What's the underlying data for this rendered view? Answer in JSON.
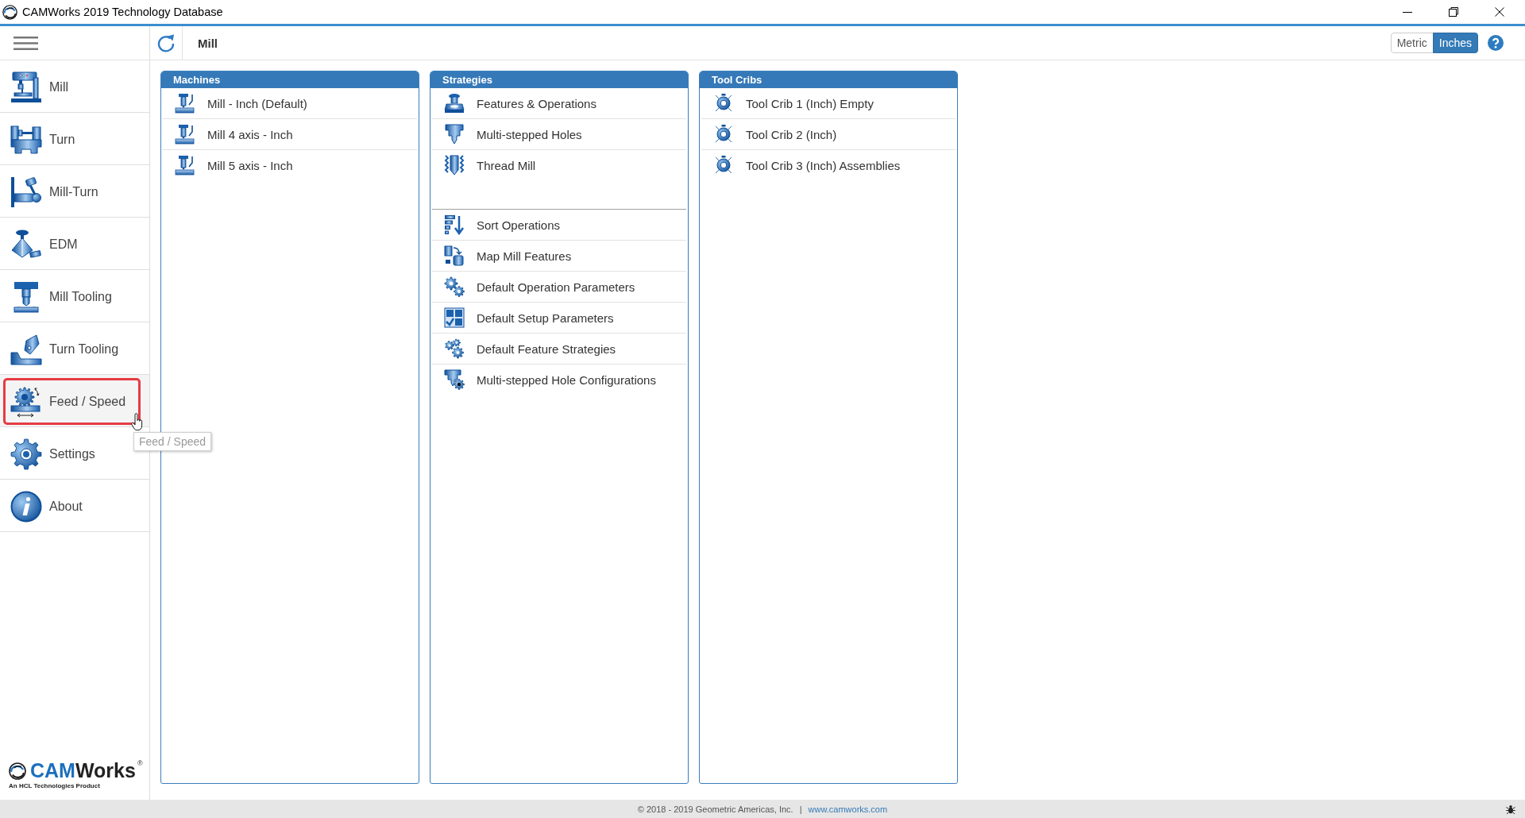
{
  "window": {
    "title": "CAMWorks 2019 Technology Database"
  },
  "toolbar": {
    "title": "Mill",
    "units": [
      {
        "label": "Metric",
        "selected": false
      },
      {
        "label": "Inches",
        "selected": true
      }
    ]
  },
  "sidebar": {
    "items": [
      {
        "label": "Mill",
        "selected": false
      },
      {
        "label": "Turn",
        "selected": false
      },
      {
        "label": "Mill-Turn",
        "selected": false
      },
      {
        "label": "EDM",
        "selected": false
      },
      {
        "label": "Mill Tooling",
        "selected": false
      },
      {
        "label": "Turn Tooling",
        "selected": false
      },
      {
        "label": "Feed / Speed",
        "selected": true
      },
      {
        "label": "Settings",
        "selected": false
      },
      {
        "label": "About",
        "selected": false
      }
    ],
    "tooltip": "Feed / Speed",
    "logo": {
      "name_start": "CAM",
      "name_end": "Works",
      "registered": "®",
      "tagline": "An HCL Technologies Product"
    }
  },
  "panels": [
    {
      "title": "Machines",
      "groups": [
        {
          "items": [
            "Mill - Inch (Default)",
            "Mill 4 axis - Inch",
            "Mill 5 axis - Inch"
          ]
        }
      ]
    },
    {
      "title": "Strategies",
      "groups": [
        {
          "items": [
            "Features & Operations",
            "Multi-stepped Holes",
            "Thread Mill"
          ]
        },
        {
          "items": [
            "Sort Operations",
            "Map Mill Features",
            "Default Operation Parameters",
            "Default Setup Parameters",
            "Default Feature Strategies",
            "Multi-stepped Hole Configurations"
          ]
        }
      ]
    },
    {
      "title": "Tool Cribs",
      "groups": [
        {
          "items": [
            "Tool Crib 1 (Inch) Empty",
            "Tool Crib 2 (Inch)",
            "Tool Crib 3 (Inch) Assemblies"
          ]
        }
      ]
    }
  ],
  "status_bar": {
    "copyright": "© 2018 - 2019 Geometric Americas, Inc.",
    "separator": "|",
    "link": "www.camworks.com"
  }
}
